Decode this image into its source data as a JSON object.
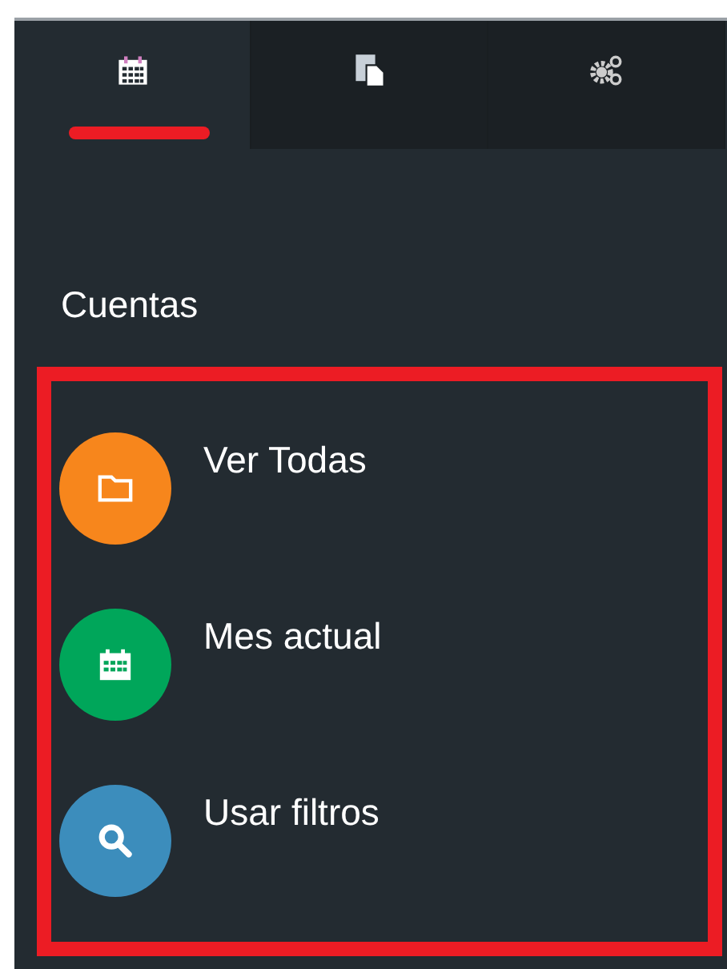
{
  "tabs": [
    {
      "kind": "calendar",
      "selected": true
    },
    {
      "kind": "documents",
      "selected": false
    },
    {
      "kind": "gears",
      "selected": false
    }
  ],
  "section": {
    "heading": "Cuentas",
    "highlighted": true,
    "items": [
      {
        "label": "Ver Todas",
        "kind": "folder",
        "color": "#f7861c"
      },
      {
        "label": "Mes actual",
        "kind": "calendar",
        "color": "#00a65a"
      },
      {
        "label": "Usar filtros",
        "kind": "search",
        "color": "#3c8dbc"
      }
    ]
  }
}
